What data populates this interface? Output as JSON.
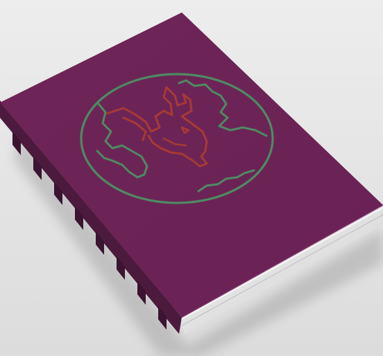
{
  "scene": {
    "subject": "book-mockup",
    "colors": {
      "background": "#e6e6e6",
      "cover": "#6d2456",
      "cover_shade": "#5e1e4a",
      "spine": "#4b1a3c",
      "spine_band": "#3a1430",
      "pages": "#d9d9d9",
      "pages_light": "#f1f1f1",
      "globe_stroke": "#4f8a63",
      "dragon_stroke": "#a83a34"
    },
    "icons": {
      "emblem": "globe-dragon-icon"
    }
  }
}
